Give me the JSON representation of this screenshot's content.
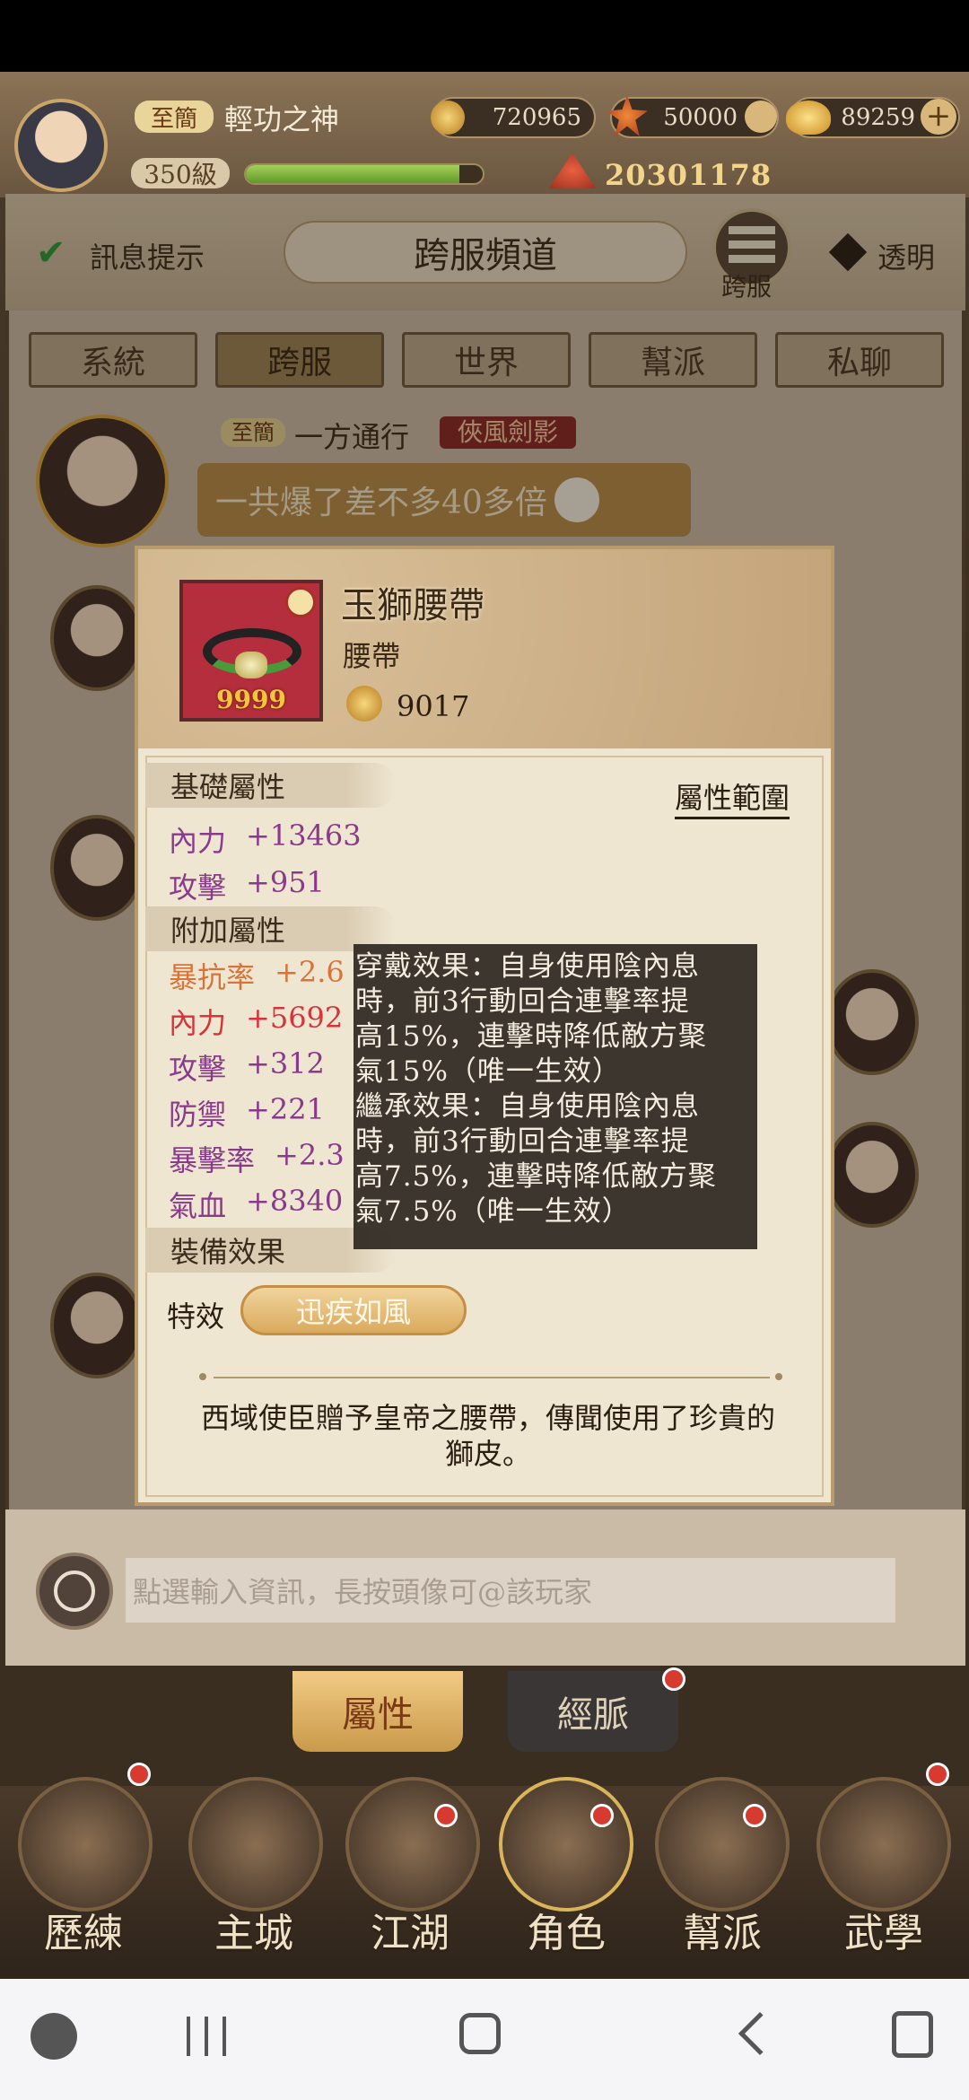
{
  "header": {
    "vip": "至簡",
    "name": "輕功之神",
    "level": "350級",
    "level_progress": 0.9,
    "silver": "720965",
    "energy": "50000",
    "ingots": "89259",
    "power": "20301178"
  },
  "channel": {
    "notify_label": "訊息提示",
    "title": "跨服頻道",
    "server_label": "跨服",
    "transparent_label": "透明",
    "tabs": [
      "系統",
      "跨服",
      "世界",
      "幫派",
      "私聊"
    ],
    "active_tab": 1
  },
  "message": {
    "vip": "至簡",
    "sender": "一方通行",
    "guild": "俠風劍影",
    "text": "一共爆了差不多40多倍"
  },
  "item": {
    "name": "玉獅腰帶",
    "type": "腰帶",
    "count": "9999",
    "score": "9017",
    "range_link": "屬性範圍",
    "base_title": "基礎屬性",
    "base_stats": [
      {
        "name": "內力",
        "value": "+13463"
      },
      {
        "name": "攻擊",
        "value": "+951"
      }
    ],
    "extra_title": "附加屬性",
    "extra_stats": [
      {
        "name": "暴抗率",
        "value": "+2.6",
        "color": "#d8733a"
      },
      {
        "name": "內力",
        "value": "+5692",
        "color": "#d7333a"
      },
      {
        "name": "攻擊",
        "value": "+312",
        "color": "#8a3a8a"
      },
      {
        "name": "防禦",
        "value": "+221",
        "color": "#8a3a8a"
      },
      {
        "name": "暴擊率",
        "value": "+2.3",
        "color": "#8a3a8a"
      },
      {
        "name": "氣血",
        "value": "+8340",
        "color": "#8a3a8a"
      }
    ],
    "equip_title": "裝備效果",
    "effect_label": "特效",
    "effect_name": "迅疾如風",
    "description": "西域使臣贈予皇帝之腰帶，傳聞使用了珍貴的獅皮。"
  },
  "tooltip": {
    "lines": [
      "穿戴效果：自身使用陰內息",
      "時，前3行動回合連擊率提",
      "高15%，連擊時降低敵方聚",
      "氣15%（唯一生效）",
      "繼承效果：自身使用陰內息",
      "時，前3行動回合連擊率提",
      "高7.5%，連擊時降低敵方聚",
      "氣7.5%（唯一生效）"
    ]
  },
  "input": {
    "placeholder": "點選輸入資訊，長按頭像可@該玩家"
  },
  "bottom_tabs": [
    "屬性",
    "經脈"
  ],
  "dock": [
    "歷練",
    "主城",
    "江湖",
    "角色",
    "幫派",
    "武學"
  ],
  "colors": {
    "accent_gold": "#d9aa5d",
    "badge_red": "#d73a2f",
    "stat_purple": "#8a3a8a"
  }
}
